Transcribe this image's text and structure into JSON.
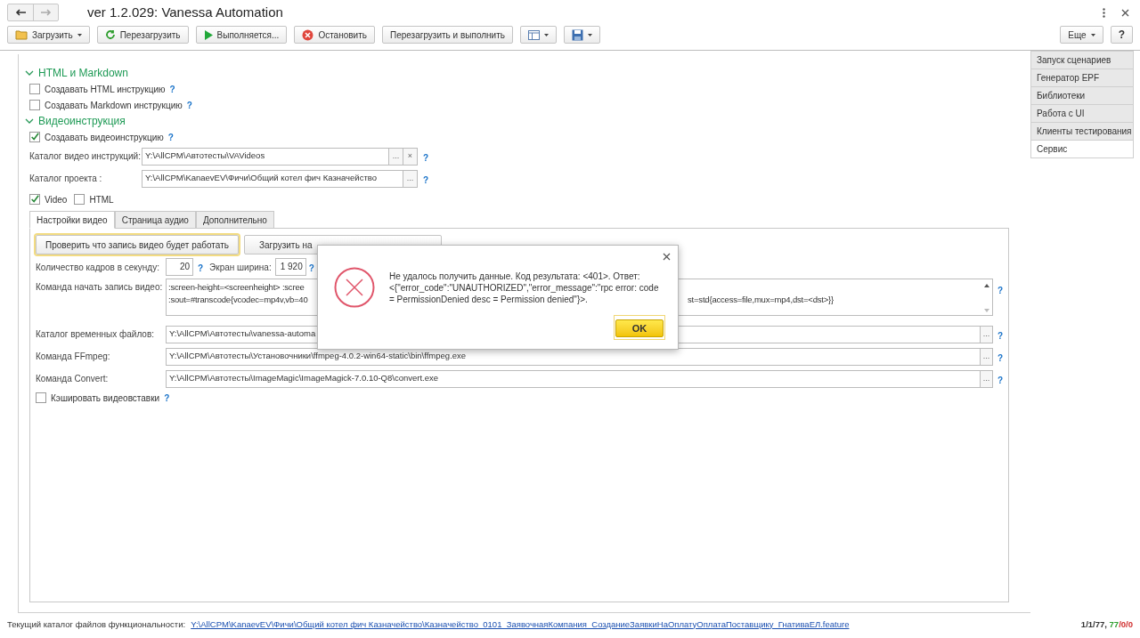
{
  "window": {
    "title": "ver 1.2.029: Vanessa Automation",
    "nav": [
      {
        "kind": "back",
        "disabled": false
      },
      {
        "kind": "forward",
        "disabled": true
      }
    ]
  },
  "toolbar": [
    {
      "kind": "folder",
      "label": "Загрузить",
      "dropdown": true
    },
    {
      "kind": "refresh",
      "label": "Перезагрузить",
      "dropdown": false
    },
    {
      "kind": "play",
      "label": "Выполняется...",
      "dropdown": false
    },
    {
      "kind": "stop",
      "label": "Остановить",
      "dropdown": false
    },
    {
      "kind": "text",
      "label": "Перезагрузить и выполнить",
      "dropdown": false
    },
    {
      "kind": "panel",
      "dropdown": true
    },
    {
      "kind": "save",
      "dropdown": true
    }
  ],
  "toolbar_right": [
    {
      "label": "Еще",
      "dropdown": true
    },
    {
      "label": "?",
      "dropdown": false
    }
  ],
  "side_tabs": [
    {
      "label": "Запуск сценариев",
      "selected": false
    },
    {
      "label": "Генератор EPF",
      "selected": false
    },
    {
      "label": "Библиотеки",
      "selected": false
    },
    {
      "label": "Работа с UI",
      "selected": false
    },
    {
      "label": "Клиенты тестирования",
      "selected": false
    },
    {
      "label": "Сервис",
      "selected": true
    }
  ],
  "html_section": {
    "title": "HTML и Markdown",
    "expanded": true,
    "checkboxes": [
      {
        "label": "Создавать HTML инструкцию",
        "checked": false,
        "help": "?"
      },
      {
        "label": "Создавать Markdown инструкцию",
        "checked": false,
        "help": "?"
      }
    ]
  },
  "video_section": {
    "title": "Видеоинструкция",
    "expanded": true,
    "create": {
      "label": "Создавать видеоинструкцию",
      "checked": true,
      "help": "?"
    },
    "fields": [
      {
        "label": "Каталог видео инструкций:",
        "value": "Y:\\AllCPM\\Автотесты\\VAVideos",
        "buttons": [
          "...",
          "×"
        ],
        "help": "?"
      },
      {
        "label": "Каталог проекта :",
        "value": "Y:\\AllCPM\\KanaevEV\\Фичи\\Общий котел фич Казначейство",
        "buttons": [
          "..."
        ],
        "help": "?"
      }
    ],
    "formats": [
      {
        "label": "Video",
        "checked": true
      },
      {
        "label": "HTML",
        "checked": false
      }
    ],
    "tabs": [
      {
        "label": "Настройки видео",
        "selected": true
      },
      {
        "label": "Страница аудио",
        "selected": false
      },
      {
        "label": "Дополнительно",
        "selected": false
      }
    ],
    "buttons": [
      {
        "label": "Проверить что запись видео будет работать",
        "default": true
      },
      {
        "label": "Загрузить на",
        "default": false
      }
    ],
    "fps": {
      "label": "Количество кадров в секунду:",
      "value": "20",
      "help": "?"
    },
    "width": {
      "label": "Экран ширина:",
      "value": "1 920",
      "help": "?"
    },
    "command": {
      "label": "Команда начать запись видео:",
      "lines": [
        {
          "left": ":screen-height=<screenheight> :scree"
        },
        {
          "left": ":sout=#transcode{vcodec=mp4v,vb=40",
          "right": "st=std{access=file,mux=mp4,dst=<dst>}}"
        }
      ],
      "help": "?"
    },
    "paths": [
      {
        "label": "Каталог временных файлов:",
        "value": "Y:\\AllCPM\\Автотесты\\vanessa-automa",
        "button": "...",
        "help": "?"
      },
      {
        "label": "Команда FFmpeg:",
        "value": "Y:\\AllCPM\\Автотесты\\Установочники\\ffmpeg-4.0.2-win64-static\\bin\\ffmpeg.exe",
        "button": "...",
        "help": "?"
      },
      {
        "label": "Команда Convert:",
        "value": "Y:\\AllCPM\\Автотесты\\ImageMagic\\ImageMagick-7.0.10-Q8\\convert.exe",
        "button": "...",
        "help": "?"
      }
    ],
    "cache": {
      "label": "Кэшировать видеовставки",
      "checked": false,
      "help": "?"
    }
  },
  "dialog": {
    "message": "Не удалось получить данные. Код результата: <401>. Ответ: <{\"error_code\":\"UNAUTHORIZED\",\"error_message\":\"rpc error: code = PermissionDenied desc = Permission denied\"}>.",
    "button": "OK"
  },
  "status_bar": {
    "label": "Текущий каталог файлов функциональности:",
    "link": "Y:\\AllCPM\\KanaevEV\\Фичи\\Общий котел фич Казначейство\\Казначейство_0101_ЗаявочнаяКомпания_СозданиеЗаявкиНаОплатуОплатаПоставщику_ГнативаЕЛ.feature",
    "counters": [
      {
        "text": "1/1/77, ",
        "color": "#333333"
      },
      {
        "text": "77",
        "color": "#2e9e2e"
      },
      {
        "text": "/0/0",
        "color": "#d03030"
      }
    ]
  }
}
